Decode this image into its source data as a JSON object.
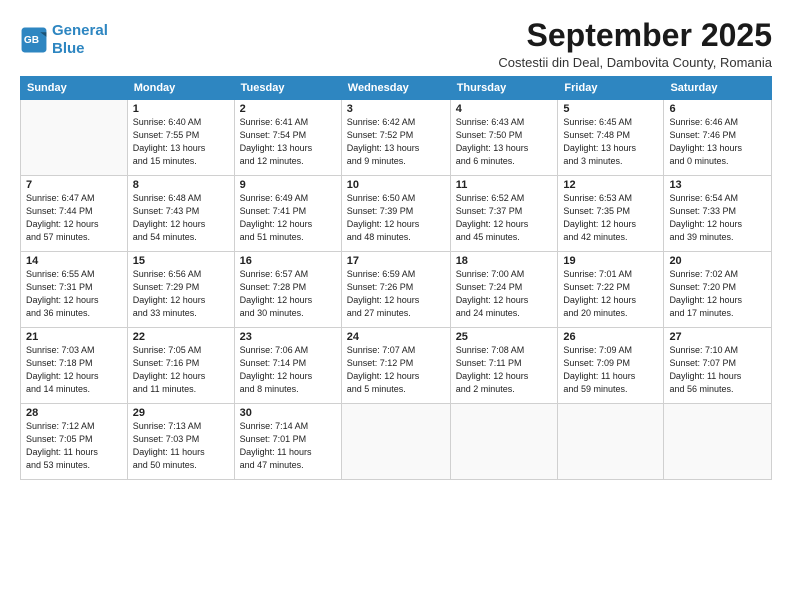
{
  "header": {
    "logo_line1": "General",
    "logo_line2": "Blue",
    "month": "September 2025",
    "location": "Costestii din Deal, Dambovita County, Romania"
  },
  "weekdays": [
    "Sunday",
    "Monday",
    "Tuesday",
    "Wednesday",
    "Thursday",
    "Friday",
    "Saturday"
  ],
  "weeks": [
    [
      {
        "day": "",
        "info": ""
      },
      {
        "day": "1",
        "info": "Sunrise: 6:40 AM\nSunset: 7:55 PM\nDaylight: 13 hours\nand 15 minutes."
      },
      {
        "day": "2",
        "info": "Sunrise: 6:41 AM\nSunset: 7:54 PM\nDaylight: 13 hours\nand 12 minutes."
      },
      {
        "day": "3",
        "info": "Sunrise: 6:42 AM\nSunset: 7:52 PM\nDaylight: 13 hours\nand 9 minutes."
      },
      {
        "day": "4",
        "info": "Sunrise: 6:43 AM\nSunset: 7:50 PM\nDaylight: 13 hours\nand 6 minutes."
      },
      {
        "day": "5",
        "info": "Sunrise: 6:45 AM\nSunset: 7:48 PM\nDaylight: 13 hours\nand 3 minutes."
      },
      {
        "day": "6",
        "info": "Sunrise: 6:46 AM\nSunset: 7:46 PM\nDaylight: 13 hours\nand 0 minutes."
      }
    ],
    [
      {
        "day": "7",
        "info": "Sunrise: 6:47 AM\nSunset: 7:44 PM\nDaylight: 12 hours\nand 57 minutes."
      },
      {
        "day": "8",
        "info": "Sunrise: 6:48 AM\nSunset: 7:43 PM\nDaylight: 12 hours\nand 54 minutes."
      },
      {
        "day": "9",
        "info": "Sunrise: 6:49 AM\nSunset: 7:41 PM\nDaylight: 12 hours\nand 51 minutes."
      },
      {
        "day": "10",
        "info": "Sunrise: 6:50 AM\nSunset: 7:39 PM\nDaylight: 12 hours\nand 48 minutes."
      },
      {
        "day": "11",
        "info": "Sunrise: 6:52 AM\nSunset: 7:37 PM\nDaylight: 12 hours\nand 45 minutes."
      },
      {
        "day": "12",
        "info": "Sunrise: 6:53 AM\nSunset: 7:35 PM\nDaylight: 12 hours\nand 42 minutes."
      },
      {
        "day": "13",
        "info": "Sunrise: 6:54 AM\nSunset: 7:33 PM\nDaylight: 12 hours\nand 39 minutes."
      }
    ],
    [
      {
        "day": "14",
        "info": "Sunrise: 6:55 AM\nSunset: 7:31 PM\nDaylight: 12 hours\nand 36 minutes."
      },
      {
        "day": "15",
        "info": "Sunrise: 6:56 AM\nSunset: 7:29 PM\nDaylight: 12 hours\nand 33 minutes."
      },
      {
        "day": "16",
        "info": "Sunrise: 6:57 AM\nSunset: 7:28 PM\nDaylight: 12 hours\nand 30 minutes."
      },
      {
        "day": "17",
        "info": "Sunrise: 6:59 AM\nSunset: 7:26 PM\nDaylight: 12 hours\nand 27 minutes."
      },
      {
        "day": "18",
        "info": "Sunrise: 7:00 AM\nSunset: 7:24 PM\nDaylight: 12 hours\nand 24 minutes."
      },
      {
        "day": "19",
        "info": "Sunrise: 7:01 AM\nSunset: 7:22 PM\nDaylight: 12 hours\nand 20 minutes."
      },
      {
        "day": "20",
        "info": "Sunrise: 7:02 AM\nSunset: 7:20 PM\nDaylight: 12 hours\nand 17 minutes."
      }
    ],
    [
      {
        "day": "21",
        "info": "Sunrise: 7:03 AM\nSunset: 7:18 PM\nDaylight: 12 hours\nand 14 minutes."
      },
      {
        "day": "22",
        "info": "Sunrise: 7:05 AM\nSunset: 7:16 PM\nDaylight: 12 hours\nand 11 minutes."
      },
      {
        "day": "23",
        "info": "Sunrise: 7:06 AM\nSunset: 7:14 PM\nDaylight: 12 hours\nand 8 minutes."
      },
      {
        "day": "24",
        "info": "Sunrise: 7:07 AM\nSunset: 7:12 PM\nDaylight: 12 hours\nand 5 minutes."
      },
      {
        "day": "25",
        "info": "Sunrise: 7:08 AM\nSunset: 7:11 PM\nDaylight: 12 hours\nand 2 minutes."
      },
      {
        "day": "26",
        "info": "Sunrise: 7:09 AM\nSunset: 7:09 PM\nDaylight: 11 hours\nand 59 minutes."
      },
      {
        "day": "27",
        "info": "Sunrise: 7:10 AM\nSunset: 7:07 PM\nDaylight: 11 hours\nand 56 minutes."
      }
    ],
    [
      {
        "day": "28",
        "info": "Sunrise: 7:12 AM\nSunset: 7:05 PM\nDaylight: 11 hours\nand 53 minutes."
      },
      {
        "day": "29",
        "info": "Sunrise: 7:13 AM\nSunset: 7:03 PM\nDaylight: 11 hours\nand 50 minutes."
      },
      {
        "day": "30",
        "info": "Sunrise: 7:14 AM\nSunset: 7:01 PM\nDaylight: 11 hours\nand 47 minutes."
      },
      {
        "day": "",
        "info": ""
      },
      {
        "day": "",
        "info": ""
      },
      {
        "day": "",
        "info": ""
      },
      {
        "day": "",
        "info": ""
      }
    ]
  ]
}
